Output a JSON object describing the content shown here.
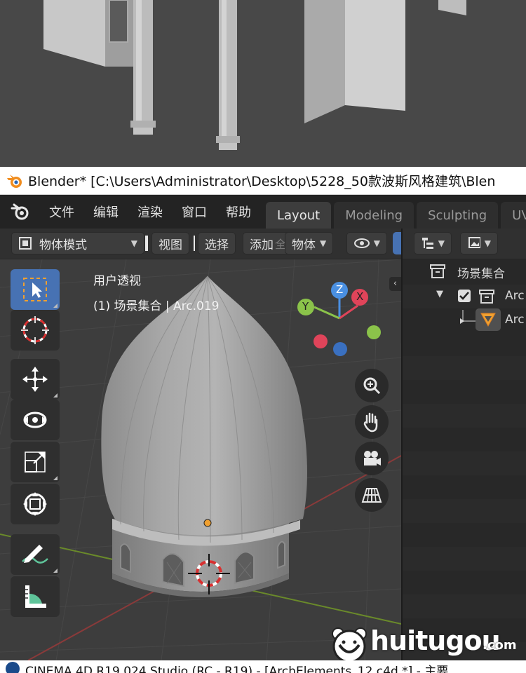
{
  "window": {
    "title": "Blender* [C:\\Users\\Administrator\\Desktop\\5228_50款波斯风格建筑\\Blen"
  },
  "menu": {
    "items": [
      "文件",
      "编辑",
      "渲染",
      "窗口",
      "帮助"
    ]
  },
  "workspaces": {
    "tabs": [
      "Layout",
      "Modeling",
      "Sculpting",
      "UV"
    ],
    "active": "Layout"
  },
  "header": {
    "mode_label": "物体模式",
    "view_label": "视图",
    "select_label": "选择",
    "add_label": "添加",
    "object_label": "物体",
    "ghost_label": "全局"
  },
  "viewport": {
    "view_name": "用户透视",
    "object_info": "(1) 场景集合 | Arc.019",
    "gizmo": {
      "x": "X",
      "y": "Y",
      "z": "Z"
    }
  },
  "toolbar": {
    "tools": [
      "select-box",
      "cursor",
      "move",
      "rotate",
      "scale",
      "transform",
      "annotate",
      "measure"
    ]
  },
  "outliner": {
    "scene_collection": "场景集合",
    "collection_item": "Arc",
    "object_item": "Arc"
  },
  "watermark": {
    "text": "huitugou",
    "suffix": ".com"
  },
  "bottom": {
    "title": "CINEMA 4D R19.024 Studio (RC - R19) - [ArchElements_12.c4d *] - 主要"
  },
  "colors": {
    "accent": "#4772b3",
    "axis_x": "#e0445a",
    "axis_y": "#8bc34a",
    "axis_z": "#4a90e2",
    "object_origin": "#f0a030"
  }
}
